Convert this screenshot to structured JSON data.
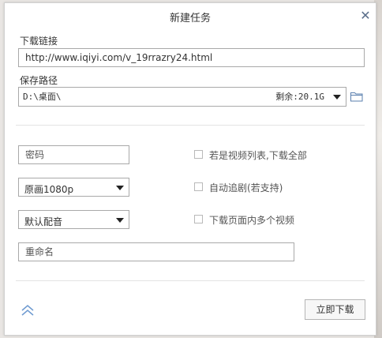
{
  "dialog": {
    "title": "新建任务",
    "close_label": "✕"
  },
  "download_link": {
    "label": "下载链接",
    "value": "http://www.iqiyi.com/v_19rrazry24.html"
  },
  "save_path": {
    "label": "保存路径",
    "value": "D:\\桌面\\",
    "free_space": "剩余:20.1G",
    "folder_icon": "folder-icon"
  },
  "password": {
    "placeholder": "密码"
  },
  "quality": {
    "selected": "原画1080p"
  },
  "audio": {
    "selected": "默认配音"
  },
  "rename": {
    "placeholder": "重命名"
  },
  "options": {
    "download_all_label": "若是视频列表,下载全部",
    "auto_follow_label": "自动追剧(若支持)",
    "multi_video_label": "下载页面内多个视频"
  },
  "footer": {
    "collapse_icon": "double-chevron-up-icon",
    "download_now_label": "立即下载"
  },
  "colors": {
    "accent_icon": "#6f9bd1",
    "border": "#a9a9a9"
  }
}
